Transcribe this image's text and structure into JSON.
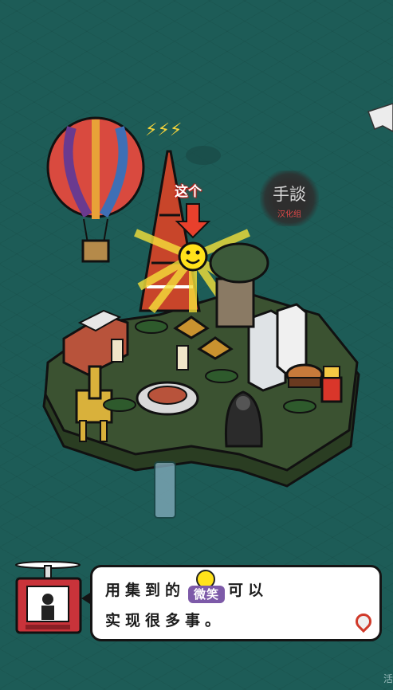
{
  "scene": {
    "callout_text": "这个",
    "badge": {
      "title": "手談",
      "subtitle": "汉化组"
    }
  },
  "dialog": {
    "line1_before": "用集到的",
    "smile_label": "微笑",
    "line1_after": "可以",
    "line2": "实现很多事。"
  },
  "corner_text": "活",
  "colors": {
    "background": "#1d5c57",
    "island": "#3b5231",
    "smile": "#ffe21a",
    "arrow": "#e8402c",
    "tower": "#c8452a",
    "smile_label_bg": "#7d5aa8"
  },
  "icons": [
    "balloon-icon",
    "tower-icon",
    "smile-icon",
    "arrow-down-icon",
    "bird-icon",
    "location-pin-icon",
    "tv-drone-icon"
  ]
}
